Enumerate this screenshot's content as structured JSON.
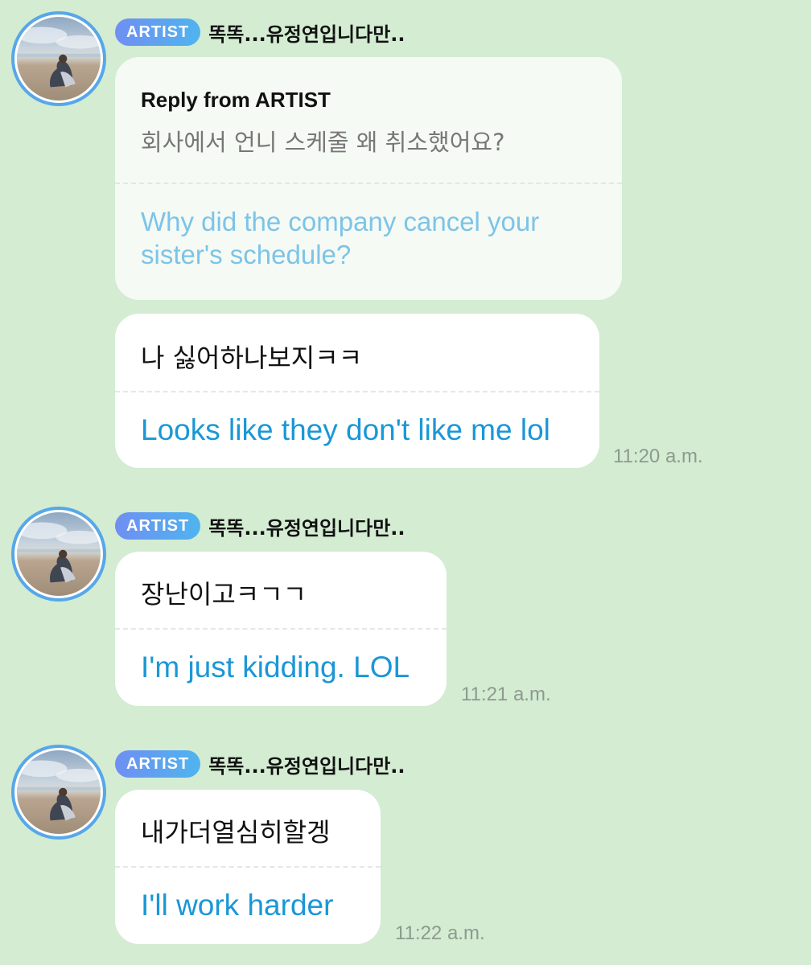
{
  "artist_badge": "ARTIST",
  "sender_name": "똑똑...유정연입니다만..",
  "reply": {
    "title": "Reply from ARTIST",
    "question_kor": "회사에서 언니 스케줄 왜 취소했어요?",
    "question_eng_line1": "Why did the company cancel your",
    "question_eng_line2": "sister's schedule?"
  },
  "messages": [
    {
      "kor": "나 싫어하나보지ㅋㅋ",
      "eng": "Looks like they don't like me lol",
      "time": "11:20 a.m."
    },
    {
      "kor": "장난이고ㅋㄱㄱ",
      "eng": "I'm just kidding. LOL",
      "time": "11:21 a.m."
    },
    {
      "kor": "내가더열심히할겡",
      "eng": "I'll work harder",
      "time": "11:22 a.m."
    }
  ],
  "colors": {
    "background": "#d3ecd2",
    "badge_start": "#6f8ff2",
    "badge_end": "#4fb4ef",
    "translation": "#1a97d6",
    "avatar_ring": "#57a7e9"
  },
  "icons": [
    "profile-avatar-photo"
  ]
}
